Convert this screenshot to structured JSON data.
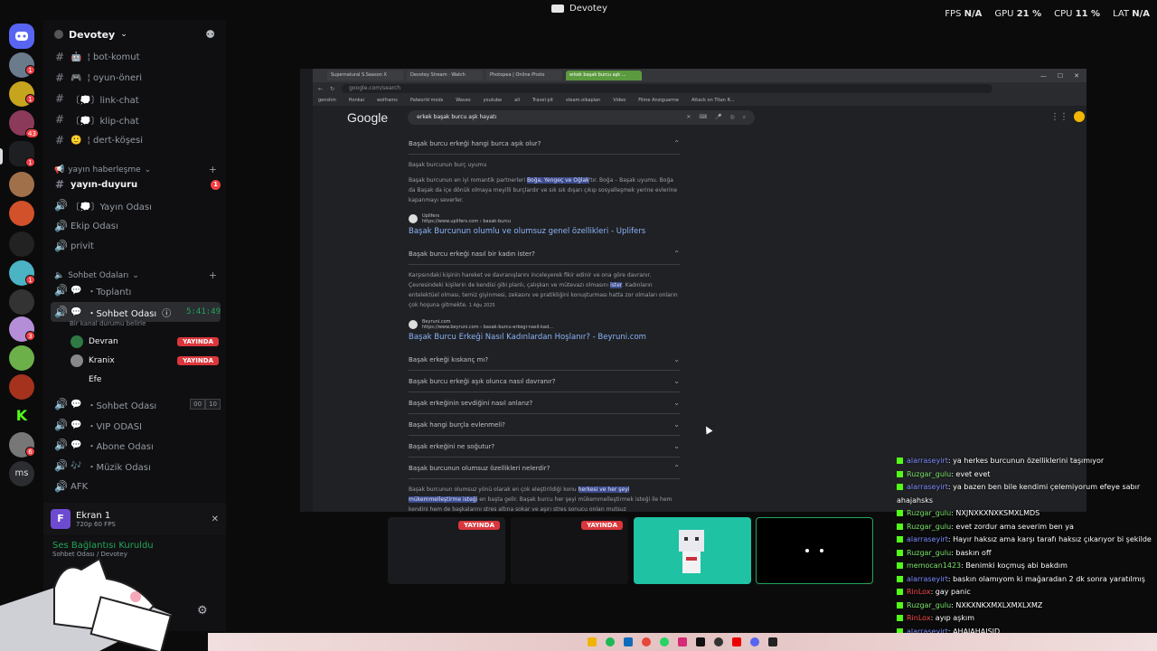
{
  "app": {
    "title": "Devotey"
  },
  "perf": [
    {
      "label": "FPS",
      "value": "N/A"
    },
    {
      "label": "GPU",
      "value": "21 %"
    },
    {
      "label": "CPU",
      "value": "11 %"
    },
    {
      "label": "LAT",
      "value": "N/A"
    }
  ],
  "server": {
    "name": "Devotey"
  },
  "rail_badges": [
    "1",
    "1",
    "43",
    "1",
    "1",
    "3",
    "1",
    "6"
  ],
  "channels": {
    "text_top": [
      "¦ bot-komut",
      "¦ oyun-öneri",
      "〔💭〕link-chat",
      "〔💭〕klip-chat",
      "¦ dert-köşesi"
    ],
    "cat_yayin": "yayın haberleşme",
    "yayin_items": [
      "yayın-duyuru",
      "〔💭〕Yayın Odası",
      "Ekip Odası",
      "privit"
    ],
    "yayin_badge": "1",
    "cat_sohbet": "Sohbet Odaları",
    "sohbet_items": [
      "・Toplantı"
    ],
    "active_voice": "・Sohbet Odası",
    "active_timer": "5:41:49",
    "status_line": "Bir kanal durumu belirle",
    "users": [
      {
        "name": "Devran",
        "live": "YAYINDA"
      },
      {
        "name": "Kranix",
        "live": "YAYINDA"
      },
      {
        "name": "Efe",
        "live": ""
      }
    ],
    "voice2": "・Sohbet Odası",
    "voice2_counts": [
      "00",
      "10"
    ],
    "others": [
      "・VIP ODASI",
      "・Abone Odası",
      "・Müzik Odası",
      "AFK"
    ]
  },
  "screen_share": {
    "title": "Ekran 1",
    "sub": "720p 60 FPS"
  },
  "voice_status": {
    "title": "Ses Bağlantısı Kuruldu",
    "sub": "Sohbet Odası / Devotey"
  },
  "browser": {
    "tabs": [
      "Supernatural S.Season X",
      "Devotey Stream · Watch",
      "Photopea | Online Photo",
      "erkek başak burcu aşk ..."
    ],
    "url": "google.com/search",
    "bookmarks": [
      "genshin",
      "Honkai",
      "wolframs",
      "Palworld mods",
      "Waves",
      "youtube",
      "all",
      "Travel pit",
      "steam.oikaplan",
      "Video",
      "Filme Ansiguarme",
      "Attack on Titan R..."
    ],
    "search_query": "erkek başak burcu aşk hayatı",
    "google_logo": "Google",
    "q1": "Başak burcu erkeği hangi burca aşık olur?",
    "a1_head": "Başak burcunun burç uyumu",
    "a1_pre": "Başak burcunun en iyi romantik partnerleri ",
    "a1_hl": "Boğa, Yengeç ve Oğlak",
    "a1_post": "'tır. Boğa – Başak uyumu. Boğa da Başak da içe dönük olmaya meyilli burçlardır ve sık sık dışarı çıkıp sosyalleşmek yerine evlerine kapanmayı severler.",
    "src1_name": "Uplifers",
    "src1_url": "https://www.uplifers.com › basak-burcu",
    "link1": "Başak Burcunun olumlu ve olumsuz genel özellikleri - Uplifers",
    "q2": "Başak burcu erkeği nasıl bir kadın ister?",
    "a2_pre": "Karşısındaki kişinin hareket ve davranışlarını inceleyerek fikir edinir ve ona göre davranır. Çevresindeki kişilerin de kendisi gibi planlı, çalışkan ve mütevazı olmasını ",
    "a2_hl": "ister",
    "a2_post": ". Kadınların entelektüel olması, temiz giyinmesi, zekasını ve pratikliğini konuşturması hatta zor olmaları onların çok hoşuna gitmekte.",
    "a2_date": "1 Ağu 2025",
    "src2_name": "Beyruni.com",
    "src2_url": "https://www.beyruni.com › basak-burcu-erkegi-nasil-kad...",
    "link2": "Başak Burcu Erkeği Nasıl Kadınlardan Hoşlanır? - Beyruni.com",
    "more_q": [
      "Başak erkeği kıskanç mı?",
      "Başak burcu erkeği aşık olunca nasıl davranır?",
      "Başak erkeğinin sevdiğini nasıl anlarız?",
      "Başak hangi burçla evlenmeli?",
      "Başak erkeğini ne soğutur?"
    ],
    "q_last": "Başak burcunun olumsuz özellikleri nelerdir?",
    "a_last_pre": "Başak burcunun olumsuz yönü olarak en çok eleştirildiği konu ",
    "a_last_hl": "herkesi ve her şeyi mükemmelleştirme isteği",
    "a_last_post": " en başta gelir. Başak burcu her şeyi mükemmelleştirmek isteği ile hem kendini hem de başkalarını stres altına sokar ve aşırı stres sonucu onları mutsuz"
  },
  "tiles": {
    "live_label": "YAYINDA"
  },
  "chat": [
    {
      "user": "alarraseyirt",
      "color": "u-blue",
      "msg": ": ya herkes burcunun özelliklerini taşımıyor"
    },
    {
      "user": "Ruzgar_gulu",
      "color": "u-green",
      "msg": ": evet evet"
    },
    {
      "user": "alarraseyirt",
      "color": "u-blue",
      "msg": ": ya bazen ben bile kendimi çelemiyorum efeye sabır ahajahsks"
    },
    {
      "user": "Ruzgar_gulu",
      "color": "u-green",
      "msg": ": NXJNXKXNXKSMXLMDS"
    },
    {
      "user": "Ruzgar_gulu",
      "color": "u-green",
      "msg": ": evet zordur ama severim ben ya"
    },
    {
      "user": "alarraseyirt",
      "color": "u-blue",
      "msg": ": Hayır haksız ama karşı tarafı haksız çıkarıyor bi şekilde"
    },
    {
      "user": "Ruzgar_gulu",
      "color": "u-green",
      "msg": ": baskın off"
    },
    {
      "user": "memocan1423",
      "color": "u-green",
      "msg": ": Benimki koçmuş abi bakdım"
    },
    {
      "user": "alarraseyirt",
      "color": "u-blue",
      "msg": ": baskın olamıyom ki mağaradan 2 dk sonra yaratılmış"
    },
    {
      "user": "RinLox",
      "color": "u-red",
      "msg": ": gay panic"
    },
    {
      "user": "Ruzgar_gulu",
      "color": "u-green",
      "msg": ": NXKXNKXMXLXMXLXMZ"
    },
    {
      "user": "RinLox",
      "color": "u-red",
      "msg": ": ayıp aşkım"
    },
    {
      "user": "alarraseyirt",
      "color": "u-blue",
      "msg": ": AHAJAHAJSJD"
    }
  ],
  "colors": {
    "live": "#da373c",
    "online": "#23a55a",
    "accent": "#5865f2"
  }
}
